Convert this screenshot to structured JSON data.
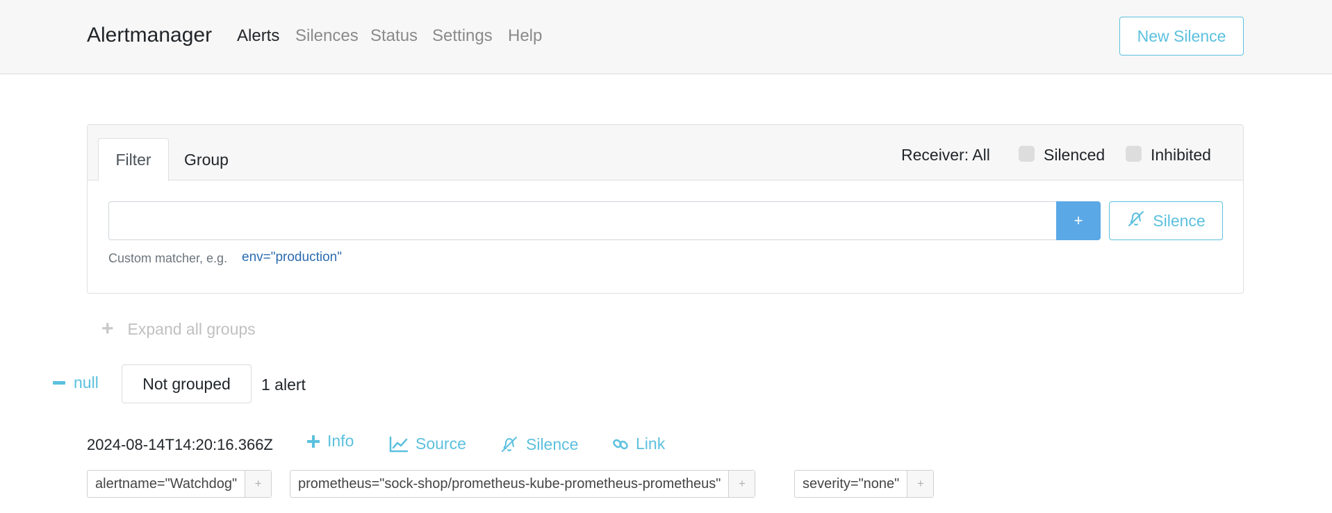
{
  "navbar": {
    "brand": "Alertmanager",
    "links": [
      "Alerts",
      "Silences",
      "Status",
      "Settings",
      "Help"
    ],
    "active_link": "Alerts",
    "new_silence_label": "New Silence"
  },
  "filter_card": {
    "tabs": [
      "Filter",
      "Group"
    ],
    "active_tab": "Filter",
    "receiver_label": "Receiver: All",
    "silenced_label": "Silenced",
    "inhibited_label": "Inhibited",
    "silenced_checked": false,
    "inhibited_checked": false,
    "input_value": "",
    "add_label": "+",
    "silence_label": "Silence",
    "hint_text": "Custom matcher, e.g.",
    "hint_example": "env=\"production\""
  },
  "expand_all_label": "Expand all groups",
  "group": {
    "toggle_label": "null",
    "group_label": "Not grouped",
    "alert_count": "1 alert",
    "alerts": [
      {
        "timestamp": "2024-08-14T14:20:16.366Z",
        "actions": [
          "Info",
          "Source",
          "Silence",
          "Link"
        ],
        "labels": [
          "alertname=\"Watchdog\"",
          "prometheus=\"sock-shop/prometheus-kube-prometheus-prometheus\"",
          "severity=\"none\""
        ]
      }
    ]
  },
  "colors": {
    "accent": "#5bc0de",
    "primary": "#5ba8e6",
    "link_blue": "#2a6bb0",
    "navbar_bg": "#f7f7f7"
  },
  "icons": {
    "info": "plus-icon",
    "source": "chart-line-icon",
    "silence": "bell-slash-icon",
    "link": "link-icon",
    "expand": "plus-icon",
    "collapse": "minus-icon"
  }
}
